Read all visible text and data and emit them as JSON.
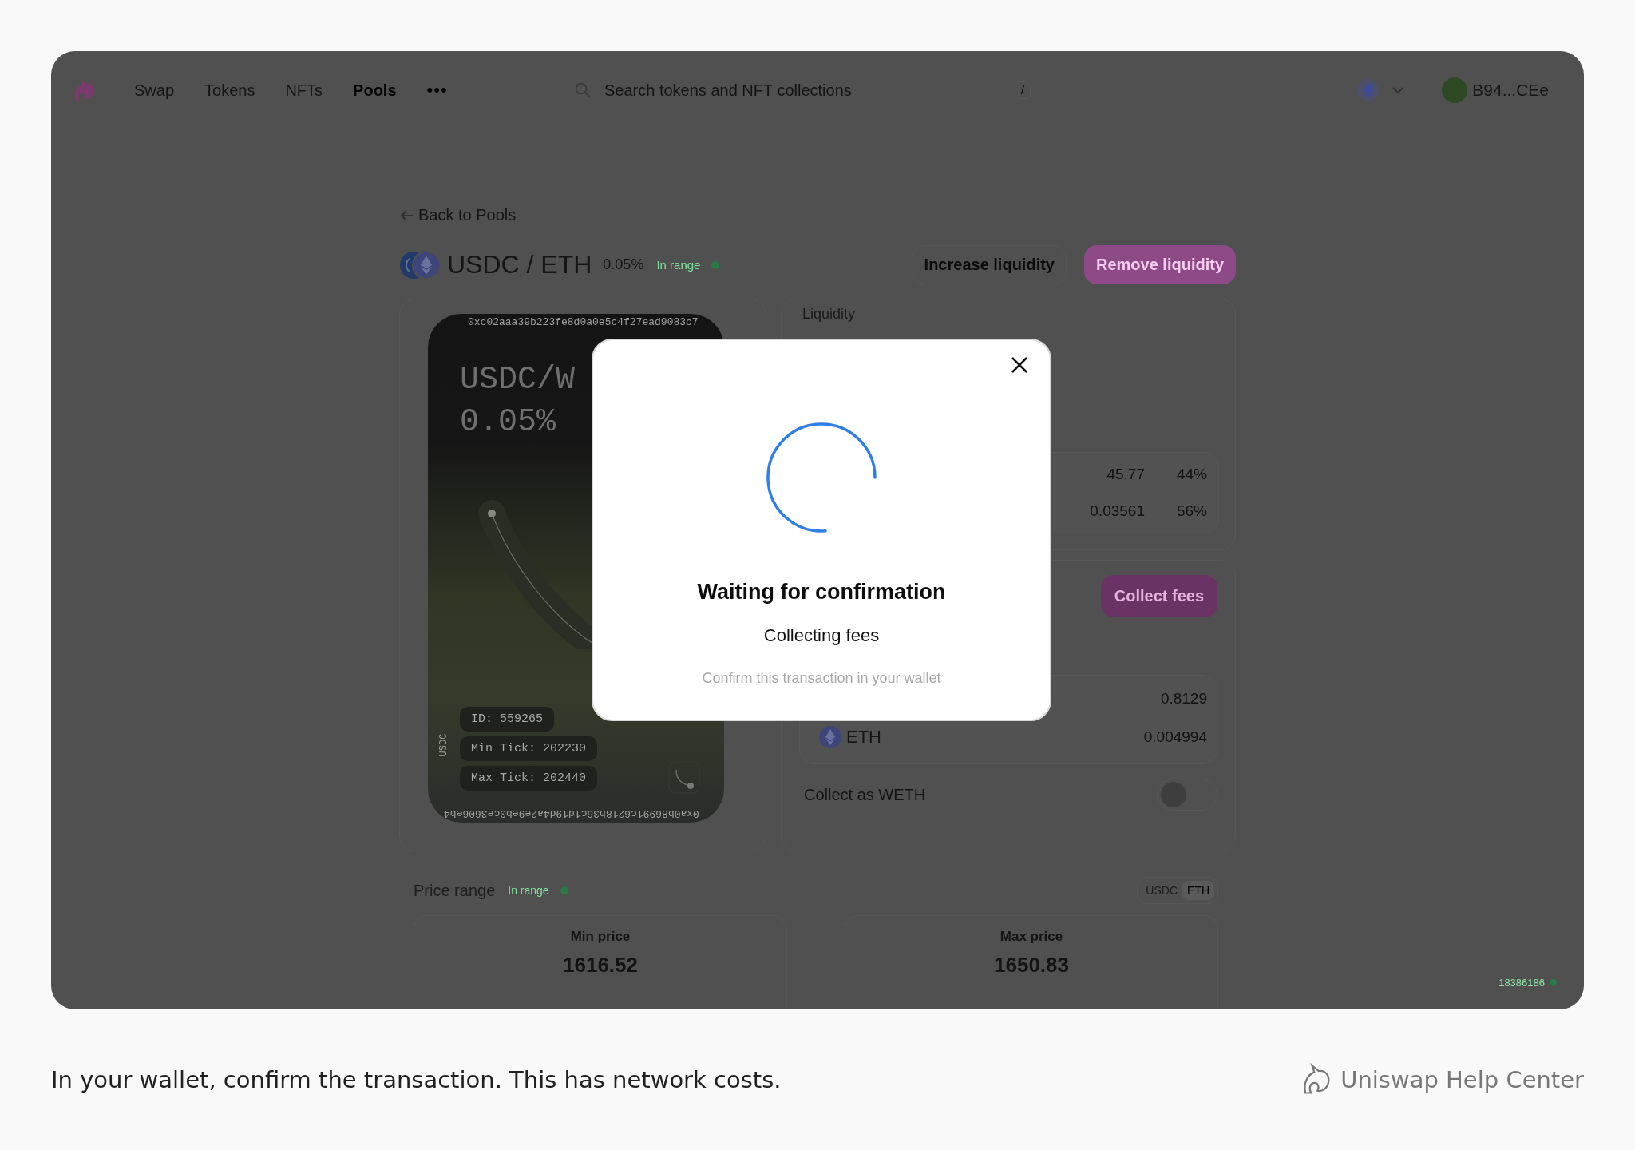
{
  "nav": {
    "items": [
      {
        "label": "Swap",
        "selected": false
      },
      {
        "label": "Tokens",
        "selected": false
      },
      {
        "label": "NFTs",
        "selected": false
      },
      {
        "label": "Pools",
        "selected": true
      }
    ],
    "more": "•••"
  },
  "search": {
    "placeholder": "Search tokens and NFT collections",
    "shortcut": "/"
  },
  "account": {
    "address": "B94...CEe"
  },
  "back_link": "Back to Pools",
  "position": {
    "pair": "USDC / ETH",
    "fee": "0.05%",
    "status": "In range",
    "in_range": true,
    "actions": [
      "Increase liquidity",
      "Remove liquidity"
    ]
  },
  "nft_card": {
    "address_top": "0xc02aaa39b223fe8d0a0e5c4f27ead9083c7",
    "title": "USDC/W",
    "fee": "0.05%",
    "badges": [
      "ID: 559265",
      "Min Tick: 202230",
      "Max Tick: 202440"
    ],
    "address_bottom": "0xa0b86991c6218b36c1d19d4a2e9eb0ce3606eb4",
    "side_label": "USDC"
  },
  "liquidity": {
    "title": "Liquidity",
    "rows": [
      {
        "amount": "45.77",
        "share": "44%"
      },
      {
        "amount": "0.03561",
        "share": "56%"
      }
    ]
  },
  "fees": {
    "button": "Collect fees",
    "rows": [
      {
        "amount": "0.8129"
      },
      {
        "kind": "eth",
        "token": "ETH",
        "amount": "0.004994"
      }
    ]
  },
  "collect_as_weth": {
    "label": "Collect as WETH",
    "on": false
  },
  "price_range": {
    "title": "Price range",
    "status": "In range",
    "in_range": true,
    "units": [
      {
        "label": "USDC",
        "selected": false
      },
      {
        "label": "ETH",
        "selected": true
      }
    ],
    "min": {
      "label": "Min price",
      "value": "1616.52"
    },
    "max": {
      "label": "Max price",
      "value": "1650.83"
    }
  },
  "block": {
    "number": "18386186"
  },
  "modal": {
    "title": "Waiting for confirmation",
    "subtitle": "Collecting fees",
    "hint": "Confirm this transaction in your wallet"
  },
  "caption": "In your wallet, confirm the transaction. This has network costs.",
  "help": {
    "label": "Uniswap Help Center"
  }
}
